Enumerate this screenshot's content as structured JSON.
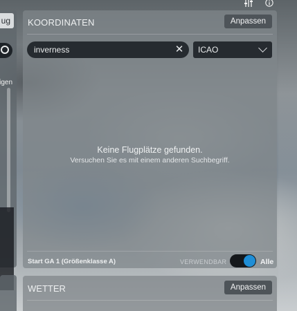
{
  "topbar": {
    "icons": [
      "sliders-icon",
      "info-icon"
    ]
  },
  "left_panel": {
    "button_label": "ug",
    "partial_text": "igen"
  },
  "coordinates": {
    "title": "KOORDINATEN",
    "customize_label": "Anpassen",
    "search": {
      "value": "inverness"
    },
    "filter_select": {
      "value": "ICAO"
    },
    "empty_state": {
      "title": "Keine Flugplätze gefunden.",
      "subtitle": "Versuchen Sie es mit einem anderen Suchbegriff."
    },
    "footer": {
      "start_label": "Start GA 1 (Größenklasse A)",
      "usable_label": "VERWENDBAR",
      "all_label": "Alle",
      "toggle_on": true,
      "toggle_color": "#1f8ed6"
    }
  },
  "weather": {
    "title": "WETTER",
    "customize_label": "Anpassen"
  }
}
